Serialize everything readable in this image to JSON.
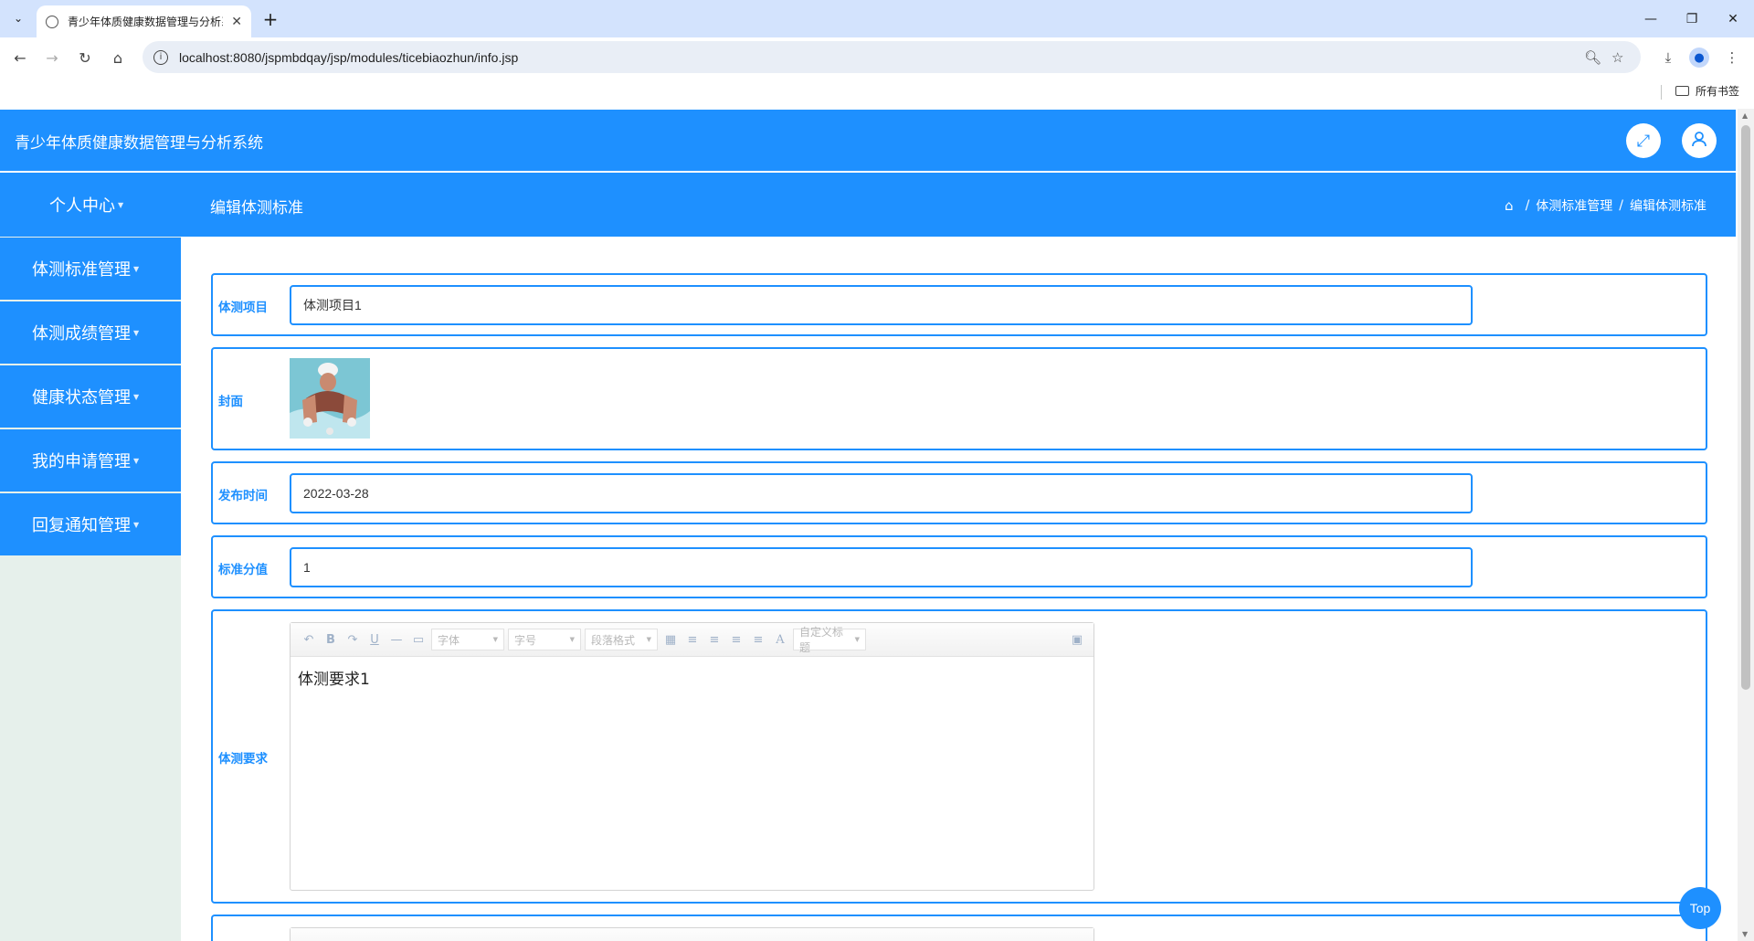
{
  "browser": {
    "tab_title": "青少年体质健康数据管理与分析系统",
    "tab_close": "✕",
    "new_tab": "+",
    "url": "localhost:8080/jspmbdqay/jsp/modules/ticebiaozhun/info.jsp",
    "bookmarks_all": "所有书签",
    "window_controls": {
      "minimize": "—",
      "restore": "❐",
      "close": "✕"
    }
  },
  "header": {
    "app_title": "青少年体质健康数据管理与分析系统",
    "fullscreen_icon": "⤢",
    "user_icon": "👤"
  },
  "sidebar": {
    "items": [
      {
        "label": "个人中心"
      },
      {
        "label": "体测标准管理"
      },
      {
        "label": "体测成绩管理"
      },
      {
        "label": "健康状态管理"
      },
      {
        "label": "我的申请管理"
      },
      {
        "label": "回复通知管理"
      }
    ],
    "caret": "▼"
  },
  "content": {
    "page_title": "编辑体测标准",
    "breadcrumb": {
      "home": "⌂",
      "sep": "/",
      "level1": "体测标准管理",
      "level2": "编辑体测标准"
    }
  },
  "form": {
    "project": {
      "label": "体测项目",
      "value": "体测项目1"
    },
    "cover": {
      "label": "封面"
    },
    "publish_time": {
      "label": "发布时间",
      "value": "2022-03-28"
    },
    "score": {
      "label": "标准分值",
      "value": "1"
    },
    "requirements": {
      "label": "体测要求",
      "content": "体测要求1"
    }
  },
  "editor_toolbar": {
    "undo": "↶",
    "bold": "B",
    "redo": "↷",
    "underline": "U",
    "hr": "—",
    "paste": "▭",
    "font_family": "字体",
    "font_size": "字号",
    "paragraph": "段落格式",
    "table": "▦",
    "align_left": "≡",
    "align_right": "≡",
    "align_center": "≡",
    "justify": "≡",
    "font_color": "A",
    "custom_title": "自定义标题",
    "fullscreen": "▣"
  },
  "scroll_top": "Top"
}
